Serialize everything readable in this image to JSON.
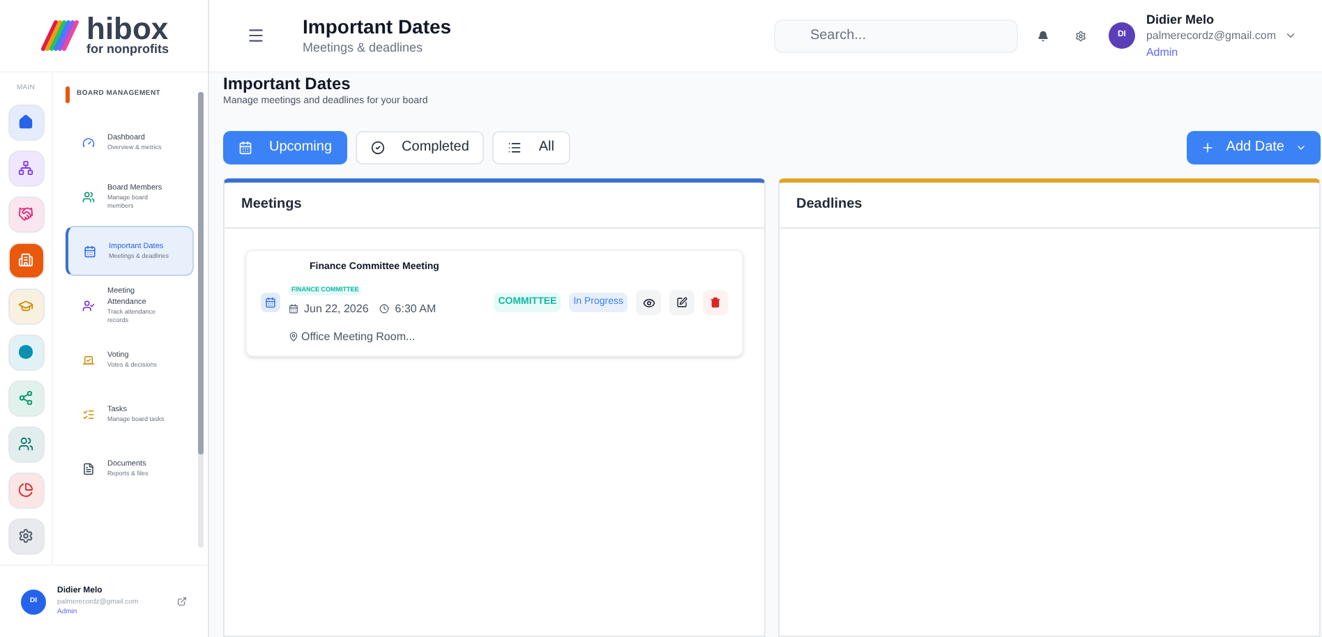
{
  "logo": {
    "name": "hibox",
    "tagline": "for nonprofits"
  },
  "rail": {
    "label": "MAIN",
    "items": [
      {
        "kind": "home",
        "color": "#2563eb",
        "selected": false
      },
      {
        "kind": "org",
        "color": "#7c3aed",
        "selected": false
      },
      {
        "kind": "handshake",
        "color": "#db2777",
        "selected": false
      },
      {
        "kind": "building",
        "color": "#ea580c",
        "selected": true
      },
      {
        "kind": "cap",
        "color": "#ca8a04",
        "selected": false
      },
      {
        "kind": "dot",
        "color": "#0891b2",
        "selected": false
      },
      {
        "kind": "share",
        "color": "#059669",
        "selected": false
      },
      {
        "kind": "users",
        "color": "#0f766e",
        "selected": false
      },
      {
        "kind": "pie",
        "color": "#dc2626",
        "selected": false
      },
      {
        "kind": "gear",
        "color": "#475569",
        "selected": false
      }
    ]
  },
  "nav": {
    "section": "BOARD MANAGEMENT",
    "items": [
      {
        "kind": "gauge",
        "title": "Dashboard",
        "subtitle": "Overview & metrics",
        "selected": false
      },
      {
        "kind": "users",
        "title": "Board Members",
        "subtitle": "Manage board members",
        "selected": false
      },
      {
        "kind": "calendar",
        "title": "Important Dates",
        "subtitle": "Meetings & deadlines",
        "selected": true
      },
      {
        "kind": "usercheck",
        "title": "Meeting Attendance",
        "subtitle": "Track attendance records",
        "selected": false
      },
      {
        "kind": "vote",
        "title": "Voting",
        "subtitle": "Votes & decisions",
        "selected": false
      },
      {
        "kind": "tasks",
        "title": "Tasks",
        "subtitle": "Manage board tasks",
        "selected": false
      },
      {
        "kind": "file",
        "title": "Documents",
        "subtitle": "Reports & files",
        "selected": false
      }
    ]
  },
  "sidebar_user": {
    "initials": "DI",
    "name": "Didier Melo",
    "email": "palmerecordz@gmail.com",
    "role": "Admin"
  },
  "header": {
    "title": "Important Dates",
    "subtitle": "Meetings & deadlines",
    "search": {
      "placeholder": "Search..."
    },
    "user": {
      "initials": "DI",
      "name": "Didier Melo",
      "email": "palmerecordz@gmail.com",
      "role": "Admin"
    }
  },
  "page": {
    "title": "Important Dates",
    "subtitle": "Manage meetings and deadlines for your board",
    "filters": [
      {
        "kind": "upcoming",
        "label": "Upcoming",
        "selected": true
      },
      {
        "kind": "completed",
        "label": "Completed",
        "selected": false
      },
      {
        "kind": "all",
        "label": "All",
        "selected": false
      }
    ],
    "add_button": "Add Date"
  },
  "columns": [
    {
      "title": "Meetings",
      "color": "#3b6fd4",
      "items": [
        {
          "title": "Finance Committee Meeting",
          "tag": "FINANCE COMMITTEE",
          "date": "Jun 22, 2026",
          "time": "6:30 AM",
          "location": "Office Meeting Room...",
          "type": "COMMITTEE",
          "status": "In Progress"
        }
      ]
    },
    {
      "title": "Deadlines",
      "color": "#e0a526"
    }
  ]
}
